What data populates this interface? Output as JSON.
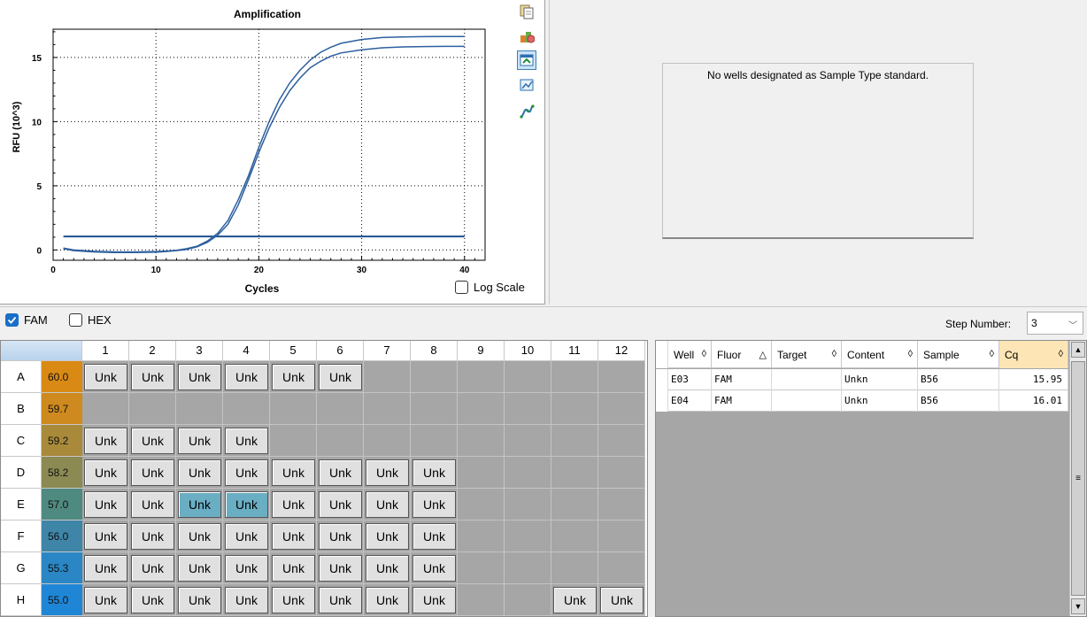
{
  "chart_data": {
    "type": "line",
    "title": "Amplification",
    "xlabel": "Cycles",
    "ylabel": "RFU (10^3)",
    "xlim": [
      0,
      42
    ],
    "ylim": [
      -0.8,
      17.2
    ],
    "xticks": [
      "0",
      "10",
      "20",
      "30",
      "40"
    ],
    "yticks": [
      "0",
      "5",
      "10",
      "15"
    ],
    "grid": true,
    "threshold": 1.05,
    "series": [
      {
        "x": [
          1,
          2,
          4,
          6,
          8,
          10,
          11,
          12,
          13,
          14,
          15,
          16,
          17,
          18,
          19,
          20,
          21,
          22,
          23,
          24,
          25,
          26,
          27,
          28,
          30,
          32,
          34,
          36,
          38,
          40
        ],
        "y": [
          0.15,
          0.0,
          -0.1,
          -0.15,
          -0.15,
          -0.12,
          -0.08,
          -0.02,
          0.1,
          0.3,
          0.7,
          1.3,
          2.3,
          3.9,
          5.8,
          8.0,
          10.0,
          11.7,
          13.0,
          14.0,
          14.8,
          15.4,
          15.8,
          16.1,
          16.4,
          16.55,
          16.6,
          16.62,
          16.63,
          16.63
        ]
      },
      {
        "x": [
          1,
          2,
          4,
          6,
          8,
          10,
          11,
          12,
          13,
          14,
          15,
          16,
          17,
          18,
          19,
          20,
          21,
          22,
          23,
          24,
          25,
          26,
          27,
          28,
          30,
          32,
          34,
          36,
          38,
          40
        ],
        "y": [
          0.1,
          -0.05,
          -0.15,
          -0.2,
          -0.2,
          -0.17,
          -0.12,
          -0.05,
          0.05,
          0.25,
          0.6,
          1.15,
          2.0,
          3.5,
          5.5,
          7.6,
          9.5,
          11.1,
          12.4,
          13.4,
          14.2,
          14.7,
          15.1,
          15.35,
          15.6,
          15.75,
          15.82,
          15.85,
          15.86,
          15.86
        ]
      }
    ],
    "log_scale": false
  },
  "chart_ui": {
    "log_scale_label": "Log Scale"
  },
  "toolbar_icons": [
    "copy-icon",
    "export-icon",
    "select-range-icon",
    "zoom-icon",
    "curve-icon"
  ],
  "standard_curve": {
    "message": "No wells designated as Sample Type standard."
  },
  "fluors": [
    {
      "label": "FAM",
      "checked": true
    },
    {
      "label": "HEX",
      "checked": false
    }
  ],
  "step": {
    "label": "Step Number:",
    "value": "3"
  },
  "plate": {
    "columns": [
      "1",
      "2",
      "3",
      "4",
      "5",
      "6",
      "7",
      "8",
      "9",
      "10",
      "11",
      "12"
    ],
    "rows": [
      {
        "id": "A",
        "temp": "60.0",
        "color": "#d98a14",
        "wells": [
          "Unk",
          "Unk",
          "Unk",
          "Unk",
          "Unk",
          "Unk",
          "",
          "",
          "",
          "",
          "",
          ""
        ]
      },
      {
        "id": "B",
        "temp": "59.7",
        "color": "#ce8a1e",
        "wells": [
          "",
          "",
          "",
          "",
          "",
          "",
          "",
          "",
          "",
          "",
          "",
          ""
        ]
      },
      {
        "id": "C",
        "temp": "59.2",
        "color": "#a88a3a",
        "wells": [
          "Unk",
          "Unk",
          "Unk",
          "Unk",
          "",
          "",
          "",
          "",
          "",
          "",
          "",
          ""
        ]
      },
      {
        "id": "D",
        "temp": "58.2",
        "color": "#8a8a52",
        "wells": [
          "Unk",
          "Unk",
          "Unk",
          "Unk",
          "Unk",
          "Unk",
          "Unk",
          "Unk",
          "",
          "",
          "",
          ""
        ]
      },
      {
        "id": "E",
        "temp": "57.0",
        "color": "#4f8a80",
        "wells": [
          "Unk",
          "Unk",
          "Unk",
          "Unk",
          "Unk",
          "Unk",
          "Unk",
          "Unk",
          "",
          "",
          "",
          ""
        ]
      },
      {
        "id": "F",
        "temp": "56.0",
        "color": "#3f85a8",
        "wells": [
          "Unk",
          "Unk",
          "Unk",
          "Unk",
          "Unk",
          "Unk",
          "Unk",
          "Unk",
          "",
          "",
          "",
          ""
        ]
      },
      {
        "id": "G",
        "temp": "55.3",
        "color": "#2a86c4",
        "wells": [
          "Unk",
          "Unk",
          "Unk",
          "Unk",
          "Unk",
          "Unk",
          "Unk",
          "Unk",
          "",
          "",
          "",
          ""
        ]
      },
      {
        "id": "H",
        "temp": "55.0",
        "color": "#1f86d6",
        "wells": [
          "Unk",
          "Unk",
          "Unk",
          "Unk",
          "Unk",
          "Unk",
          "Unk",
          "Unk",
          "",
          "",
          "Unk",
          "Unk"
        ]
      }
    ],
    "selected": [
      "E3",
      "E4"
    ]
  },
  "results": {
    "columns": [
      {
        "label": "Well",
        "sort": "◊"
      },
      {
        "label": "Fluor",
        "sort": "△"
      },
      {
        "label": "Target",
        "sort": "◊"
      },
      {
        "label": "Content",
        "sort": "◊"
      },
      {
        "label": "Sample",
        "sort": "◊"
      },
      {
        "label": "Cq",
        "sort": "◊"
      }
    ],
    "rows": [
      [
        "E03",
        "FAM",
        "",
        "Unkn",
        "B56",
        "15.95"
      ],
      [
        "E04",
        "FAM",
        "",
        "Unkn",
        "B56",
        "16.01"
      ]
    ]
  },
  "colors": {
    "curve": "#2d5f9e",
    "threshold": "#1f4f8f",
    "plate_bg": "#a6a6a6",
    "selected_well": "#6aaec4"
  }
}
